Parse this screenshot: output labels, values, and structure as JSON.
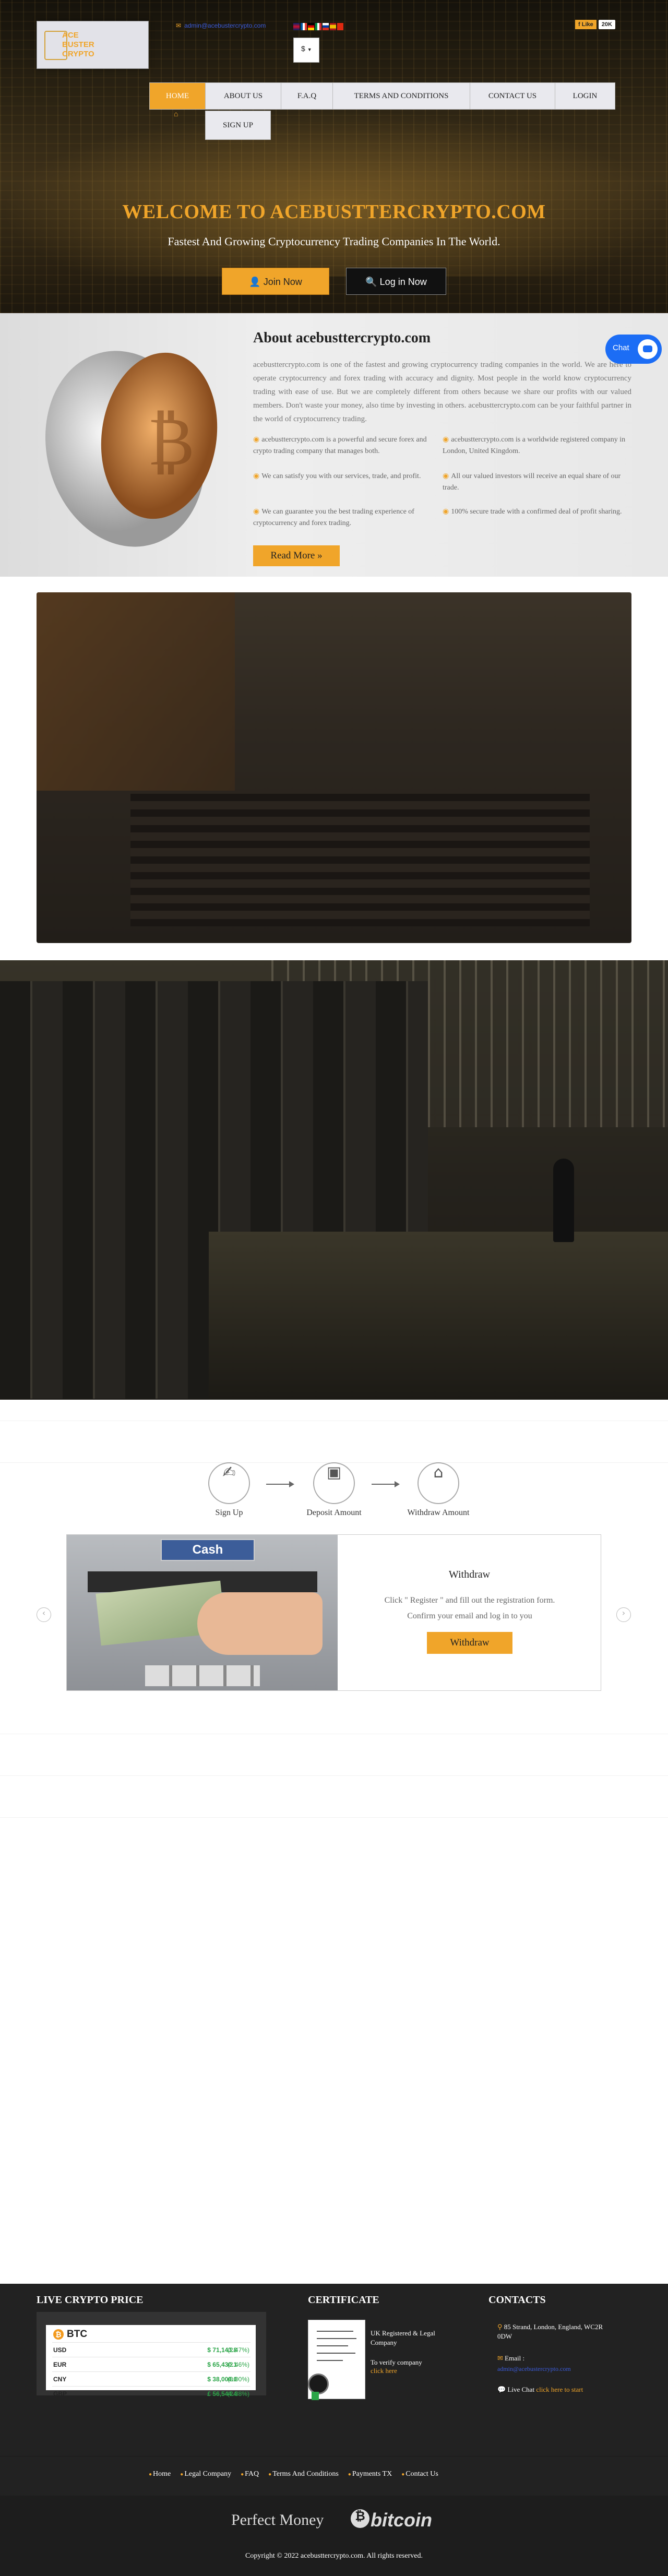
{
  "header": {
    "logo_text": [
      "ACE",
      "BUSTER",
      "CRYPTO"
    ],
    "email": "admin@acebustercrypto.com",
    "currency": "$",
    "fb_like": "Like",
    "fb_count": "20K"
  },
  "nav": {
    "items": [
      {
        "label": "HOME"
      },
      {
        "label": "ABOUT US"
      },
      {
        "label": "F.A.Q"
      },
      {
        "label": "TERMS AND CONDITIONS"
      },
      {
        "label": "CONTACT US"
      },
      {
        "label": "LOGIN"
      }
    ],
    "signup": "SIGN UP"
  },
  "hero": {
    "title": "WELCOME TO ACEBUSTTERCRYPTO.COM",
    "subtitle": "Fastest And Growing Cryptocurrency Trading Companies In The World.",
    "join": "Join Now",
    "login": "Log in Now"
  },
  "about": {
    "title": "About acebusttercrypto.com",
    "text": "acebusttercrypto.com is one of the fastest and growing cryptocurrency trading companies in the world. We are here to operate cryptocurrency and forex trading with accuracy and dignity. Most people in the world know cryptocurrency trading with ease of use. But we are completely different from others because we share our profits with our valued members. Don't waste your money, also time by investing in others. acebusttercrypto.com can be your faithful partner in the world of cryptocurrency trading.",
    "features": [
      "acebusttercrypto.com is a powerful and secure forex and crypto trading company that manages both.",
      "acebusttercrypto.com is a worldwide registered company in London, United Kingdom.",
      "We can satisfy you with our services, trade, and profit.",
      "All our valued investors will receive an equal share of our trade.",
      "We can guarantee you the best trading experience of cryptocurrency and forex trading.",
      "100% secure trade with a confirmed deal of profit sharing."
    ],
    "read_more": "Read More",
    "chat": "Chat"
  },
  "how": {
    "steps": [
      "Sign Up",
      "Deposit Amount",
      "Withdraw Amount"
    ],
    "card_cash": "Cash",
    "card_title": "Withdraw",
    "card_text": "Click \" Register \" and fill out the registration form. Confirm your email and log in to you",
    "card_button": "Withdraw"
  },
  "footer": {
    "price_title": "LIVE CRYPTO PRICE",
    "coin": "BTC",
    "prices": [
      {
        "currency": "USD",
        "value": "$ 71,143.8",
        "change": "(2.47%)"
      },
      {
        "currency": "EUR",
        "value": "$ 65,430.1",
        "change": "(2.46%)"
      },
      {
        "currency": "CNY",
        "value": "$ 38,000.0",
        "change": "(0.00%)"
      },
      {
        "currency": "GBP",
        "value": "£ 56,544.4",
        "change": "(2.38%)"
      }
    ],
    "cert_title": "CERTIFICATE",
    "cert_text": "UK Registered & Legal Company",
    "cert_verify": "To verify company",
    "cert_click": "click here",
    "contacts_title": "CONTACTS",
    "address": "85 Strand, London, England, WC2R 0DW",
    "email_label": "Email :",
    "email": "admin@acebustercrypto.com",
    "live_chat": "Live Chat",
    "live_chat_link": "click here to start",
    "links": [
      "Home",
      "Legal Company",
      "FAQ",
      "Terms And Conditions",
      "Payments TX",
      "Contact Us"
    ],
    "perfect_money": "Perfect Money",
    "bitcoin": "bitcoin",
    "copyright": "Copyright © 2022 acebusttercrypto.com. All rights reserved."
  },
  "colors": {
    "accent": "#f0a52a",
    "dark": "#222222",
    "positive": "#2ba548",
    "chat": "#1c6df5"
  }
}
